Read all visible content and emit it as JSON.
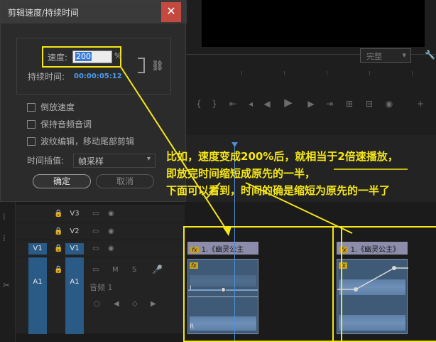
{
  "dialog": {
    "title": "剪辑速度/持续时间",
    "close_glyph": "✕",
    "speed_label": "速度:",
    "speed_value": "200",
    "percent_sign": "%",
    "duration_label": "持续时间:",
    "duration_value": "00:00:05:12",
    "checkboxes": [
      {
        "label": "倒放速度",
        "checked": false
      },
      {
        "label": "保持音频音调",
        "checked": false
      },
      {
        "label": "波纹编辑，移动尾部剪辑",
        "checked": false
      }
    ],
    "interp_label": "时间插值:",
    "interp_value": "帧采样",
    "ok_label": "确定",
    "cancel_label": "取消"
  },
  "monitor": {
    "fit_value": "完整"
  },
  "annotation": {
    "line1": "比如，速度变成200%后，就相当于2倍速播放，",
    "line2": "即放完时间缩短成原先的一半，",
    "line3": "下面可以看到，时间的确是缩短为原先的一半了"
  },
  "timeline": {
    "tracks": [
      {
        "src": "",
        "id": "V3"
      },
      {
        "src": "",
        "id": "V2"
      },
      {
        "src": "V1",
        "id": "V1"
      },
      {
        "src": "A1",
        "id": "A1"
      }
    ],
    "a1_name": "音频 1",
    "clip_v_left": "1.《幽灵公主",
    "clip_v_right": "1.《幽灵公主》",
    "fx_label": "fx",
    "mute_label": "M",
    "solo_label": "S",
    "audio_left_label": "L",
    "audio_right_label": "R"
  },
  "colors": {
    "accent_blue": "#2a5a86",
    "annotation_yellow": "#f5e618",
    "close_red": "#c44a3f"
  }
}
